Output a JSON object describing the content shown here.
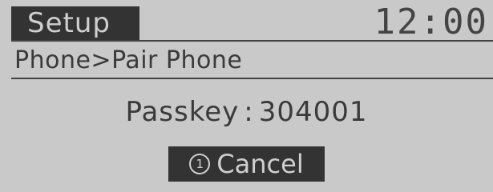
{
  "header": {
    "title": "Setup",
    "time": "12:00"
  },
  "breadcrumb": "Phone>Pair Phone",
  "passkey": {
    "label": "Passkey",
    "separator": ":",
    "value": "304001"
  },
  "cancel_button": {
    "number": "1",
    "label": "Cancel"
  }
}
